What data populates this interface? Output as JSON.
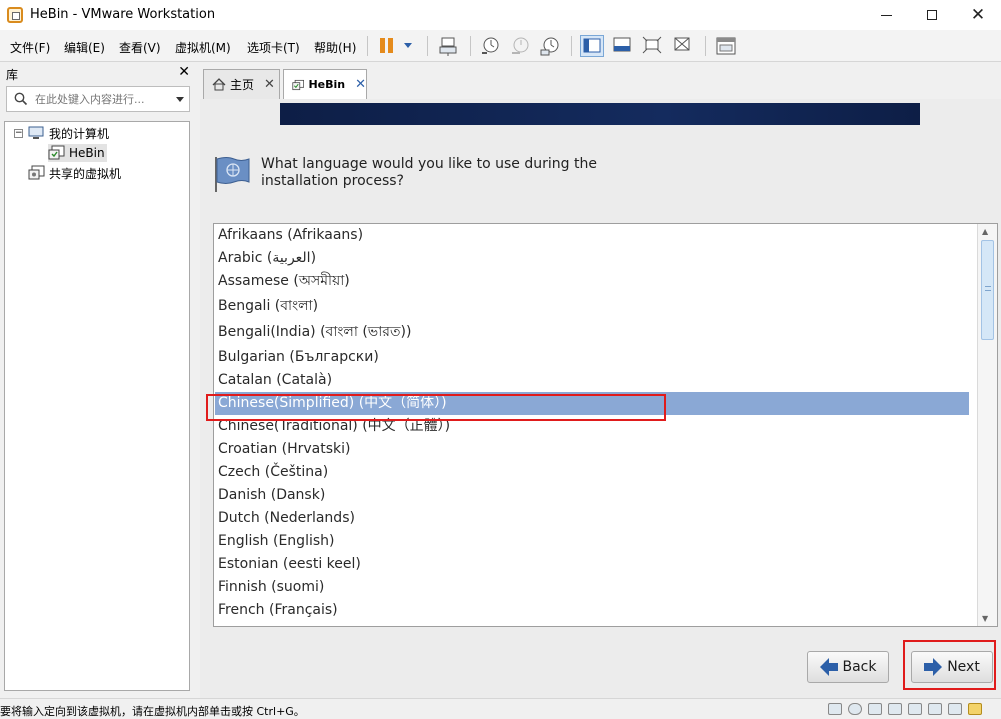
{
  "window": {
    "title": "HeBin - VMware Workstation",
    "controls": [
      "minimize",
      "maximize",
      "close"
    ]
  },
  "menu": {
    "items": [
      "文件(F)",
      "编辑(E)",
      "查看(V)",
      "虚拟机(M)",
      "选项卡(T)",
      "帮助(H)"
    ]
  },
  "toolbar": {
    "accent_color": "#e58b1c",
    "icons": [
      "pause-icon",
      "dropdown-icon",
      "send-keys-icon",
      "snapshot-take-icon",
      "snapshot-revert-icon",
      "snapshot-manager-icon",
      "library-view-icon",
      "console-view-icon",
      "fullscreen-icon",
      "unity-icon",
      "thumbnail-view-icon"
    ]
  },
  "library": {
    "title": "库",
    "search_placeholder": "在此处键入内容进行...",
    "tree": {
      "root": "我的计算机",
      "vm": "HeBin",
      "shared": "共享的虚拟机"
    }
  },
  "tabs": [
    {
      "label": "主页"
    },
    {
      "label": "HeBin"
    }
  ],
  "installer": {
    "prompt_line1": "What language would you like to use during the",
    "prompt_line2": "installation process?",
    "selected_index": 7,
    "languages": [
      "Afrikaans (Afrikaans)",
      "Arabic (العربية)",
      "Assamese (অসমীয়া)",
      "Bengali (বাংলা)",
      "Bengali(India) (বাংলা (ভারত))",
      "Bulgarian (Български)",
      "Catalan (Català)",
      "Chinese(Simplified) (中文（简体）)",
      "Chinese(Traditional) (中文（正體）)",
      "Croatian (Hrvatski)",
      "Czech (Čeština)",
      "Danish (Dansk)",
      "Dutch (Nederlands)",
      "English (English)",
      "Estonian (eesti keel)",
      "Finnish (suomi)",
      "French (Français)"
    ],
    "back_label": "Back",
    "next_label": "Next"
  },
  "statusbar": {
    "message": "要将输入定向到该虚拟机，请在虚拟机内部单击或按 Ctrl+G。"
  }
}
